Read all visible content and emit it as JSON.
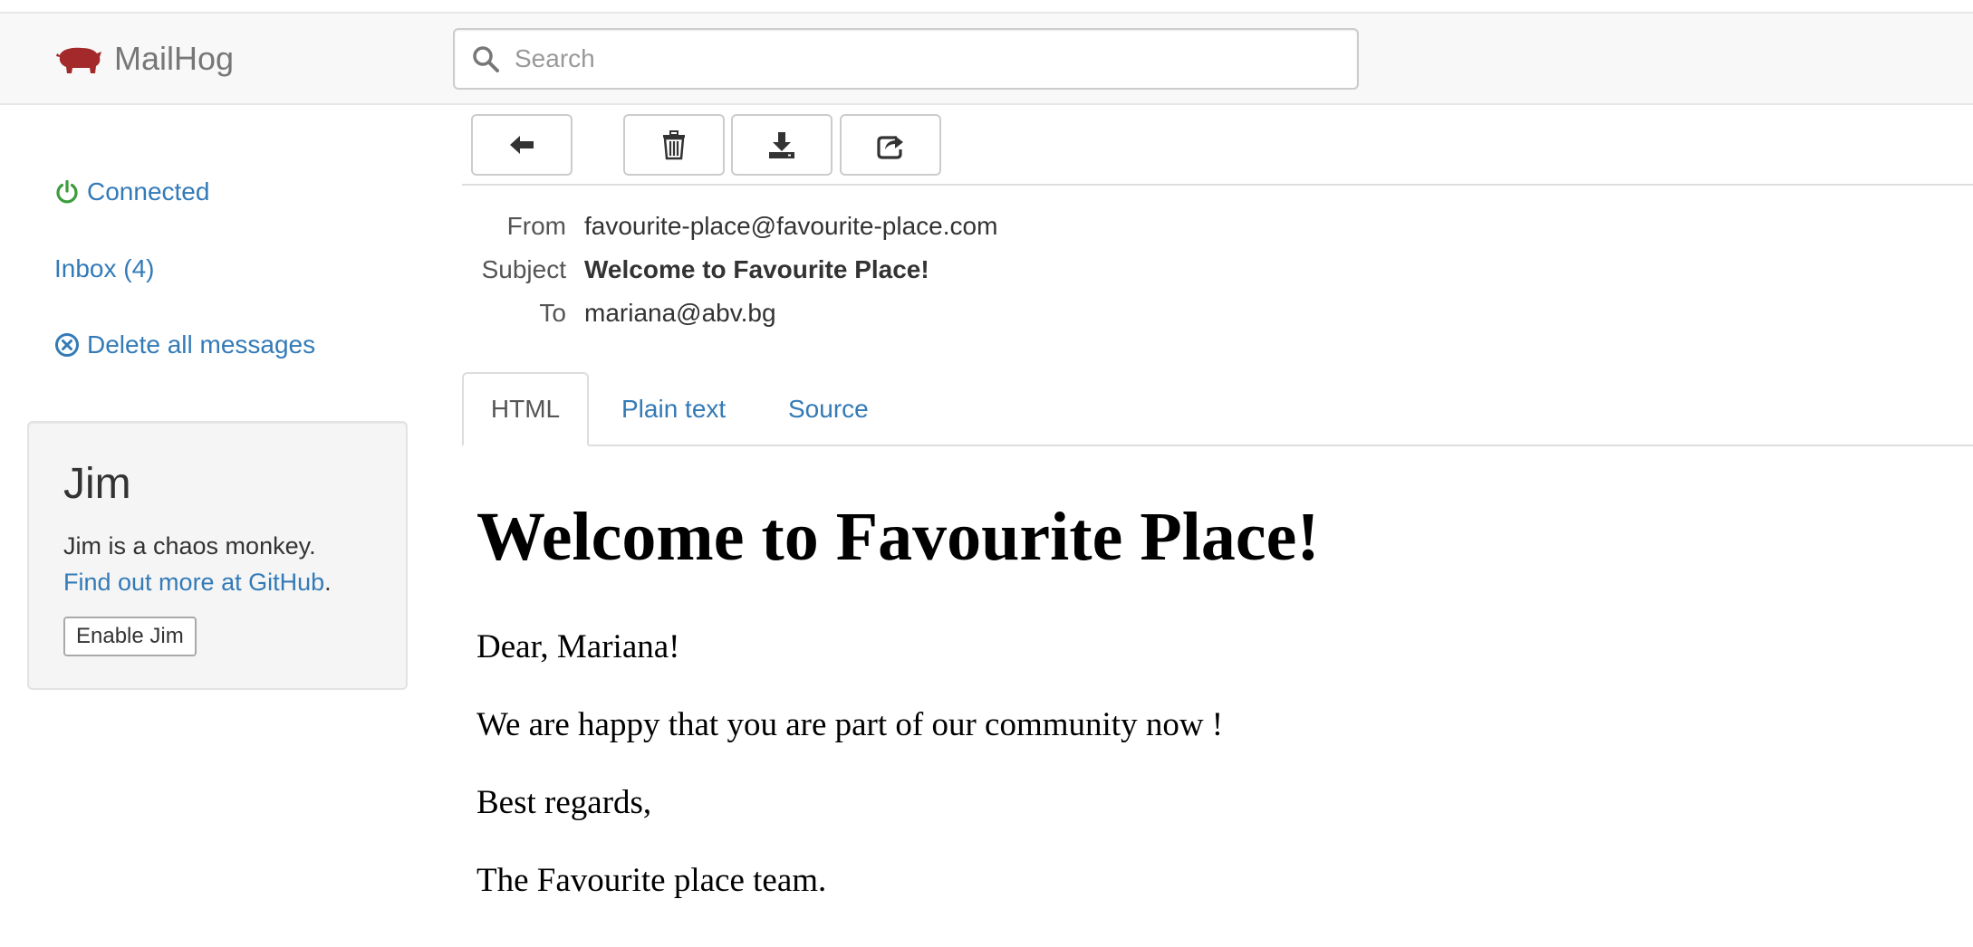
{
  "app": {
    "name": "MailHog",
    "colors": {
      "brand_red": "#a3292a",
      "link": "#337ab7",
      "connected": "#3c9c3c"
    }
  },
  "search": {
    "placeholder": "Search"
  },
  "sidebar": {
    "connected_label": "Connected",
    "inbox_label": "Inbox (4)",
    "delete_all_label": "Delete all messages"
  },
  "jim": {
    "title": "Jim",
    "description": "Jim is a chaos monkey.",
    "github_link": "Find out more at GitHub",
    "github_suffix": ".",
    "enable_button": "Enable Jim"
  },
  "toolbar": {
    "buttons": [
      {
        "icon": "arrow-left-icon",
        "action": "back"
      },
      {
        "icon": "trash-icon",
        "action": "delete"
      },
      {
        "icon": "download-icon",
        "action": "download"
      },
      {
        "icon": "share-icon",
        "action": "release"
      }
    ]
  },
  "message": {
    "headers": {
      "from_label": "From",
      "from_value": "favourite-place@favourite-place.com",
      "subject_label": "Subject",
      "subject_value": "Welcome to Favourite Place!",
      "to_label": "To",
      "to_value": "mariana@abv.bg"
    },
    "tabs": [
      {
        "label": "HTML",
        "active": true
      },
      {
        "label": "Plain text",
        "active": false
      },
      {
        "label": "Source",
        "active": false
      }
    ],
    "body": {
      "heading": "Welcome to Favourite Place!",
      "paragraphs": [
        "Dear, Mariana!",
        "We are happy that you are part of our community now !",
        "Best regards,",
        "The Favourite place team."
      ]
    }
  }
}
